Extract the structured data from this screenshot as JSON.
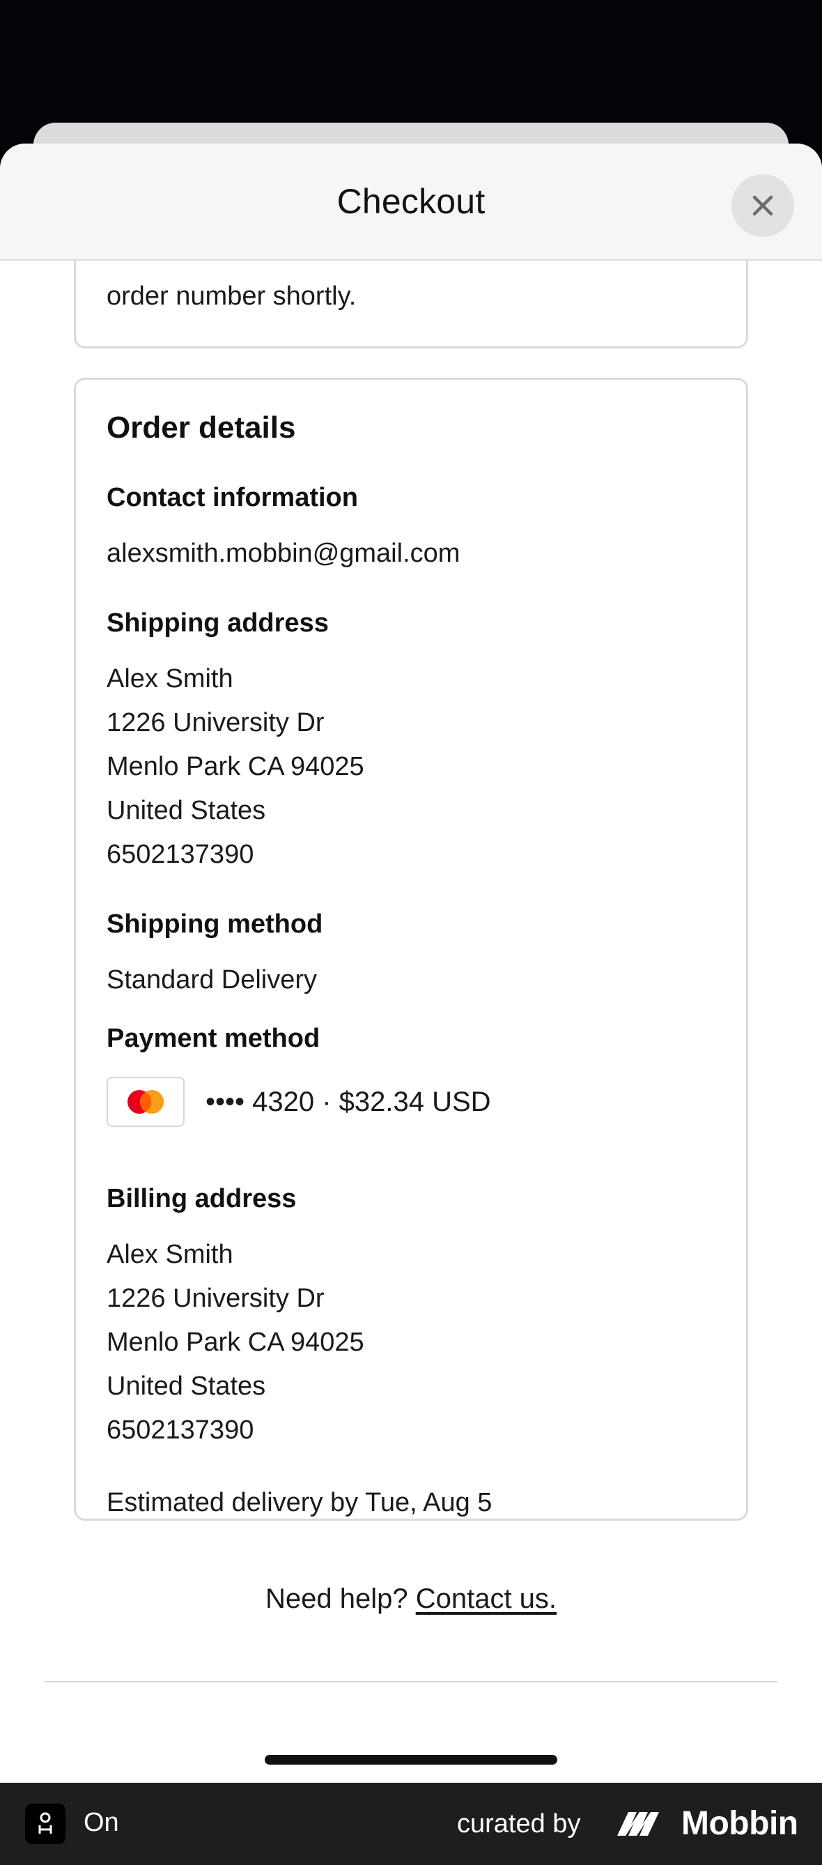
{
  "header": {
    "title": "Checkout",
    "close_label": "Close"
  },
  "confirmation": {
    "message_tail": "order number shortly."
  },
  "order_details": {
    "title": "Order details",
    "contact": {
      "heading": "Contact information",
      "email": "alexsmith.mobbin@gmail.com"
    },
    "shipping_address": {
      "heading": "Shipping address",
      "lines": [
        "Alex Smith",
        "1226 University Dr",
        "Menlo Park CA 94025",
        "United States",
        "6502137390"
      ]
    },
    "shipping_method": {
      "heading": "Shipping method",
      "value": "Standard Delivery"
    },
    "payment_method": {
      "heading": "Payment method",
      "card_brand_icon": "mastercard-icon",
      "summary": "•••• 4320 · $32.34 USD"
    },
    "billing_address": {
      "heading": "Billing address",
      "lines": [
        "Alex Smith",
        "1226 University Dr",
        "Menlo Park CA 94025",
        "United States",
        "6502137390"
      ]
    },
    "estimated_delivery": "Estimated delivery by Tue, Aug 5"
  },
  "help": {
    "prefix": "Need help?",
    "link": "Contact us."
  },
  "footer": {
    "status": "On",
    "curated_by": "curated by",
    "brand": "Mobbin"
  },
  "colors": {
    "backdrop": "#050208",
    "sheet_header": "#f6f6f7",
    "card_border": "#dadada",
    "mastercard_red": "#eb001b",
    "mastercard_orange": "#f79e1b",
    "footer_bg": "#1e1e1e"
  }
}
